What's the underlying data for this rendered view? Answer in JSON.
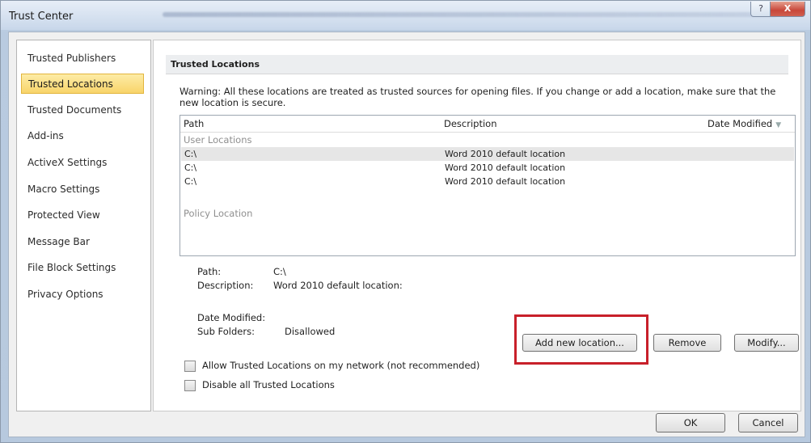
{
  "window": {
    "title": "Trust Center",
    "help_glyph": "?",
    "close_glyph": "X"
  },
  "nav": {
    "items": [
      {
        "label": "Trusted Publishers"
      },
      {
        "label": "Trusted Locations",
        "selected": true
      },
      {
        "label": "Trusted Documents"
      },
      {
        "label": "Add-ins"
      },
      {
        "label": "ActiveX Settings"
      },
      {
        "label": "Macro Settings"
      },
      {
        "label": "Protected View"
      },
      {
        "label": "Message Bar"
      },
      {
        "label": "File Block Settings"
      },
      {
        "label": "Privacy Options"
      }
    ]
  },
  "section": {
    "title": "Trusted Locations",
    "warning": "Warning: All these locations are treated as trusted sources for opening files.  If you change or add a location, make sure that the new location is secure."
  },
  "locations": {
    "columns": {
      "path": "Path",
      "description": "Description",
      "date_modified": "Date Modified"
    },
    "user_group": "User Locations",
    "rows": [
      {
        "path": "C:\\",
        "description": "Word 2010 default location",
        "selected": true
      },
      {
        "path": "C:\\",
        "description": "Word 2010 default location"
      },
      {
        "path": "C:\\",
        "description": "Word 2010 default location"
      }
    ],
    "policy_group": "Policy Location"
  },
  "details": {
    "path_label": "Path:",
    "path_value": "C:\\",
    "description_label": "Description:",
    "description_value": "Word 2010 default location:",
    "date_modified_label": "Date Modified:",
    "sub_folders_label": "Sub Folders:",
    "sub_folders_value": "Disallowed"
  },
  "buttons": {
    "add_new": "Add new location...",
    "remove": "Remove",
    "modify": "Modify...",
    "ok": "OK",
    "cancel": "Cancel"
  },
  "options": {
    "allow_network": "Allow Trusted Locations on my network (not recommended)",
    "disable_all": "Disable all Trusted Locations"
  },
  "colors": {
    "highlight": "#c8202a",
    "selected_nav": "#f8d46a"
  }
}
